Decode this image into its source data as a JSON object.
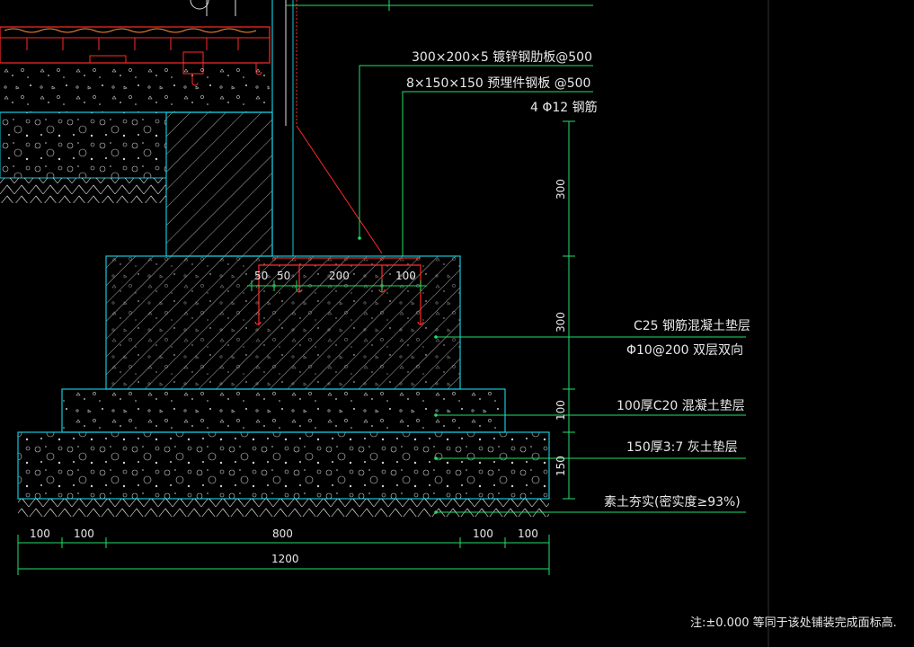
{
  "drawing": {
    "background": "#000000",
    "line_colors": {
      "outline": "#16c6d6",
      "dimension": "#22e06a",
      "leader": "#22e06a",
      "rebar": "#ff2a2a",
      "hatch": "#e6e6e6",
      "text": "#e8e8e8"
    },
    "callouts": {
      "steel_plate": "300×200×5 镀锌钢肋板@500",
      "embedded_plate": "8×150×150 预埋件钢板  @500",
      "rebar": "4 Φ12  钢筋",
      "c25_layer": "C25 钢筋混凝土垫层",
      "c25_rebar": "Φ10@200    双层双向",
      "c20_layer": "100厚C20 混凝土垫层",
      "lime_soil": "150厚3:7 灰土垫层",
      "compacted_soil": "素土夯实(密实度≥93%)"
    },
    "vertical_dims": [
      "300",
      "300",
      "100",
      "150"
    ],
    "inner_dims": [
      "50",
      "50",
      "200",
      "100"
    ],
    "bottom_dims": [
      "100",
      "100",
      "800",
      "100",
      "100"
    ],
    "total_width": "1200",
    "note": "注:±0.000 等同于该处铺装完成面标高."
  }
}
